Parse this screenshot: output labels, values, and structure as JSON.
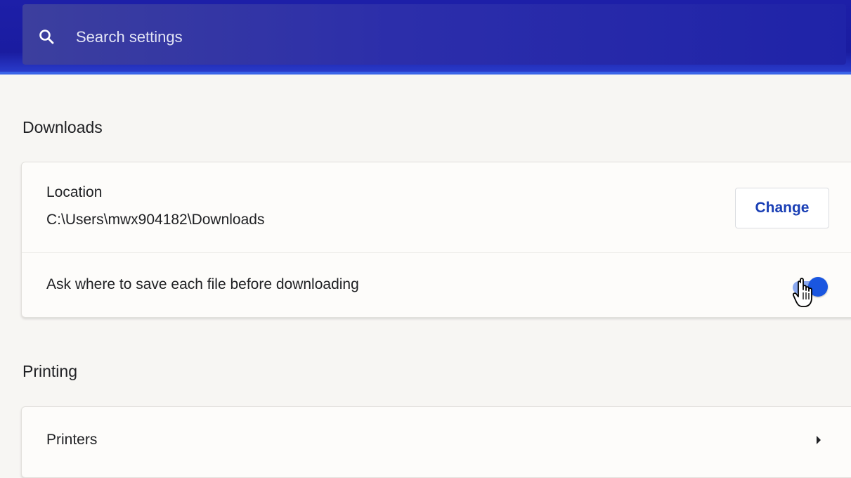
{
  "search": {
    "placeholder": "Search settings"
  },
  "downloads": {
    "title": "Downloads",
    "location_label": "Location",
    "location_path": "C:\\Users\\mwx904182\\Downloads",
    "change_label": "Change",
    "ask_label": "Ask where to save each file before downloading",
    "ask_enabled": true
  },
  "printing": {
    "title": "Printing",
    "printers_label": "Printers"
  },
  "colors": {
    "header": "#1d1fa8",
    "accent": "#1a56e0",
    "button_text": "#1a3fb5"
  },
  "icons": [
    "search-icon",
    "hand-cursor-icon",
    "chevron-right-icon"
  ]
}
